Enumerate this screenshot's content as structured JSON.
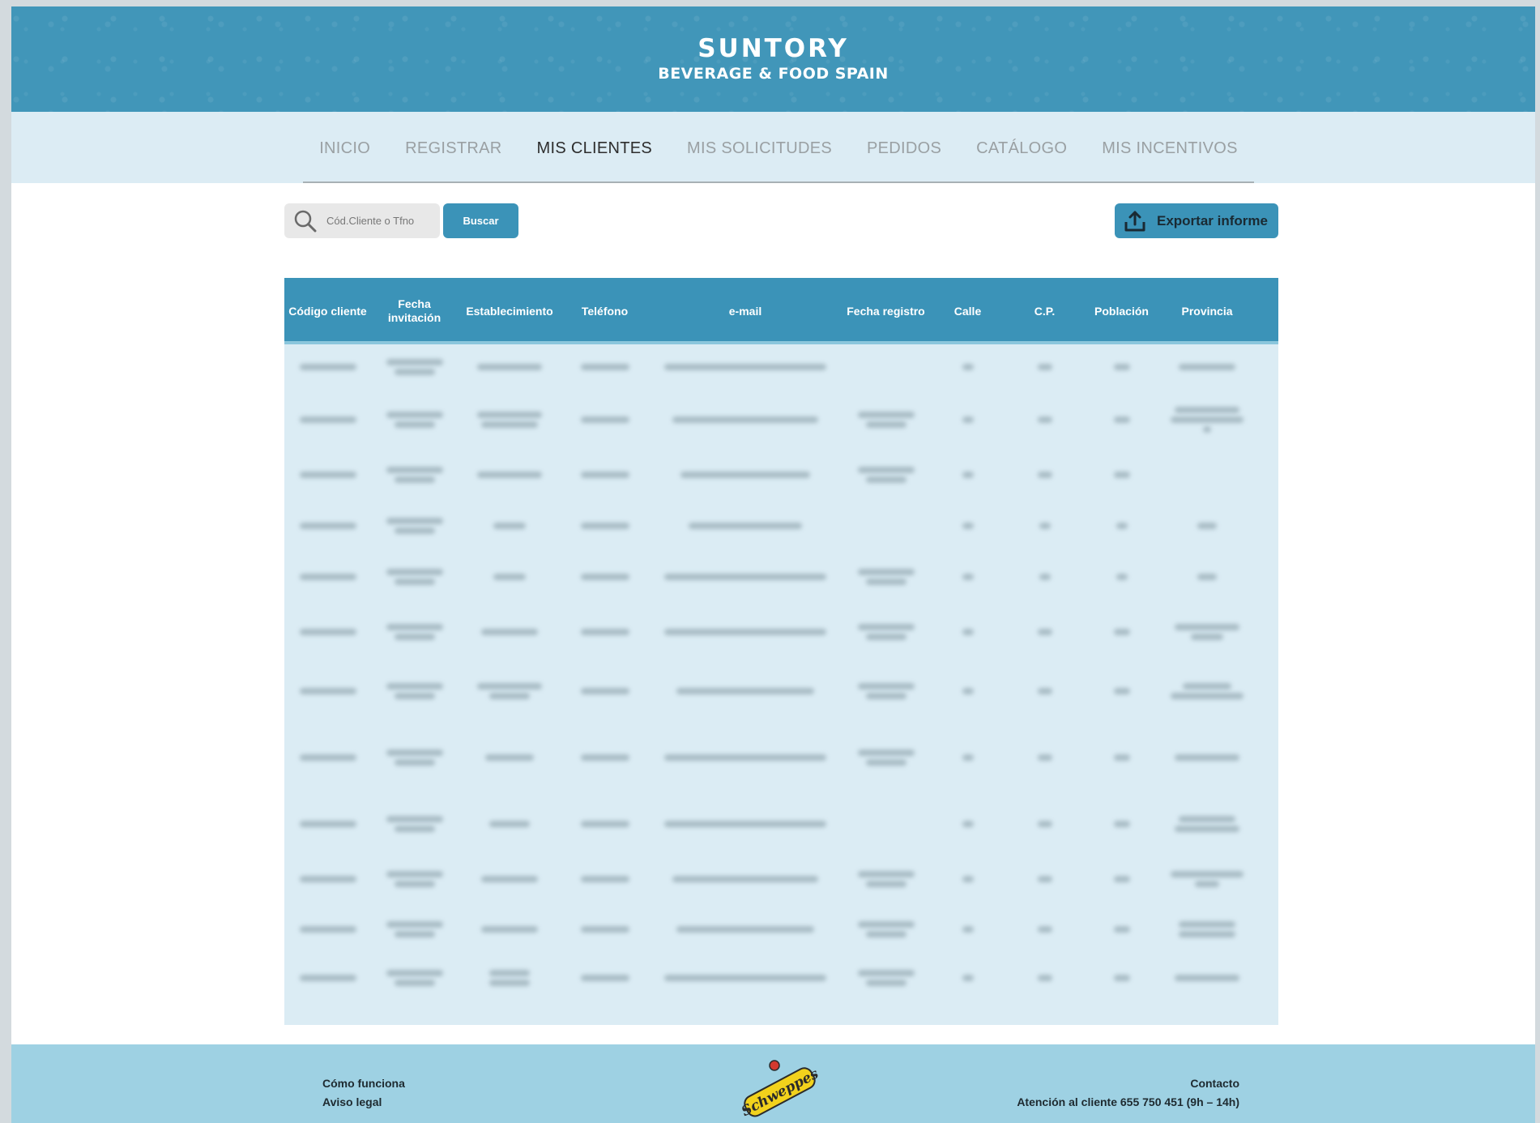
{
  "brand": {
    "name": "suntory",
    "subtitle": "BEVERAGE & FOOD SPAIN",
    "header_color": "#4196b9",
    "accent_color": "#3b93b8"
  },
  "nav": {
    "items": [
      {
        "label": "INICIO",
        "active": false
      },
      {
        "label": "REGISTRAR",
        "active": false
      },
      {
        "label": "MIS CLIENTES",
        "active": true
      },
      {
        "label": "MIS SOLICITUDES",
        "active": false
      },
      {
        "label": "PEDIDOS",
        "active": false
      },
      {
        "label": "CATÁLOGO",
        "active": false
      },
      {
        "label": "MIS INCENTIVOS",
        "active": false
      }
    ]
  },
  "toolbar": {
    "search_placeholder": "Cód.Cliente o Tfno",
    "search_icon": "search-icon",
    "search_button": "Buscar",
    "export_button": "Exportar informe",
    "export_icon": "upload-icon"
  },
  "table": {
    "headers": [
      {
        "label": "Código cliente"
      },
      {
        "label": "Fecha invitación"
      },
      {
        "label": "Establecimiento"
      },
      {
        "label": "Teléfono"
      },
      {
        "label": "e-mail"
      },
      {
        "label": "Fecha registro"
      },
      {
        "label": "Calle"
      },
      {
        "label": "C.P."
      },
      {
        "label": "Población"
      },
      {
        "label": "Provincia"
      }
    ],
    "rows_note": "Row contents are blurred/redacted in the screenshot",
    "row_count": 12
  },
  "footer": {
    "how_it_works": "Cómo funciona",
    "legal": "Aviso legal",
    "contact_title": "Contacto",
    "contact_text": "Atención al cliente 655 750 451 (9h – 14h)",
    "logo": "Schweppes"
  }
}
